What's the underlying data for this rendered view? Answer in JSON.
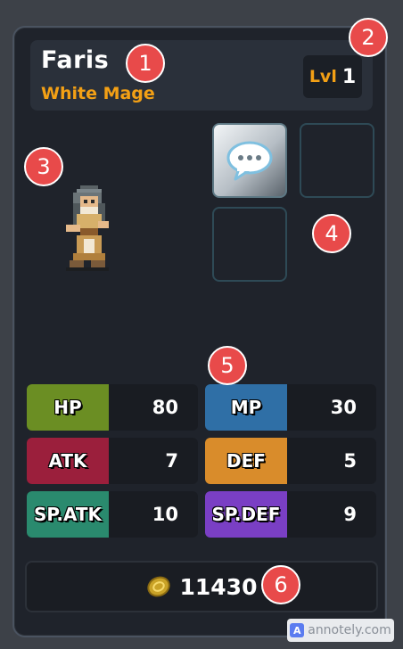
{
  "character": {
    "name": "Faris",
    "class_name": "White Mage",
    "level_label": "Lvl",
    "level": "1"
  },
  "equipment_slots": [
    {
      "icon": "speech-bubble-icon",
      "filled": true
    },
    {
      "icon": "",
      "filled": false
    },
    {
      "icon": "",
      "filled": false
    }
  ],
  "stats": [
    {
      "label": "HP",
      "value": "80",
      "color": "#6b8e23"
    },
    {
      "label": "MP",
      "value": "30",
      "color": "#2f6fa6"
    },
    {
      "label": "ATK",
      "value": "7",
      "color": "#9b1f3c"
    },
    {
      "label": "DEF",
      "value": "5",
      "color": "#d98c2b"
    },
    {
      "label": "SP.ATK",
      "value": "10",
      "color": "#2a8a6e"
    },
    {
      "label": "SP.DEF",
      "value": "9",
      "color": "#7a3fc4"
    }
  ],
  "gold": {
    "icon": "coin-icon",
    "value": "11430"
  },
  "annotations": [
    "1",
    "2",
    "3",
    "4",
    "5",
    "6"
  ],
  "watermark": "annotely.com",
  "colors": {
    "accent": "#f3a015",
    "badge": "#e84a4a",
    "panel": "#1f232b"
  }
}
